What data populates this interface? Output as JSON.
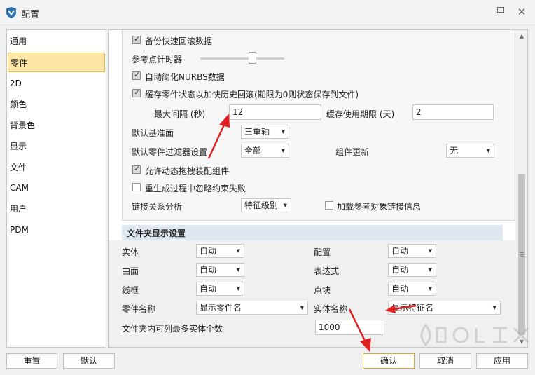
{
  "window": {
    "title": "配置"
  },
  "colors": {
    "accent": "#fde6a8",
    "accent_border": "#e9b84f",
    "annotation_arrow": "#e02020"
  },
  "sidebar": {
    "items": [
      {
        "label": "通用",
        "selected": false
      },
      {
        "label": "零件",
        "selected": true
      },
      {
        "label": "2D",
        "selected": false
      },
      {
        "label": "颜色",
        "selected": false
      },
      {
        "label": "背景色",
        "selected": false
      },
      {
        "label": "显示",
        "selected": false
      },
      {
        "label": "文件",
        "selected": false
      },
      {
        "label": "CAM",
        "selected": false
      },
      {
        "label": "用户",
        "selected": false
      },
      {
        "label": "PDM",
        "selected": false
      }
    ]
  },
  "options": {
    "backup_rollback": {
      "label": "备份快速回滚数据",
      "checked": true
    },
    "ref_timer": {
      "label": "参考点计时器"
    },
    "auto_simplify": {
      "label": "自动简化NURBS数据",
      "checked": true
    },
    "cache_state": {
      "label": "缓存零件状态以加快历史回滚(期限为0则状态保存到文件)",
      "checked": true
    },
    "max_interval": {
      "label": "最大间隔 (秒)",
      "value": "12"
    },
    "cache_limit": {
      "label": "缓存使用期限 (天)",
      "value": "2"
    },
    "default_plane": {
      "label": "默认基准面",
      "value": "三重轴"
    },
    "default_filter": {
      "label": "默认零件过滤器设置",
      "value": "全部"
    },
    "component_update": {
      "label": "组件更新",
      "value": "无"
    },
    "allow_drag": {
      "label": "允许动态拖拽装配组件",
      "checked": true
    },
    "ignore_constraint": {
      "label": "重生成过程中忽略约束失败",
      "checked": false
    },
    "link_analysis": {
      "label": "链接关系分析",
      "value": "特征级别"
    },
    "load_ref_link": {
      "label": "加载参考对象链接信息",
      "checked": false
    }
  },
  "folder_display": {
    "title": "文件夹显示设置",
    "solid": {
      "label": "实体",
      "value": "自动"
    },
    "config": {
      "label": "配置",
      "value": "自动"
    },
    "surface": {
      "label": "曲面",
      "value": "自动"
    },
    "expression": {
      "label": "表达式",
      "value": "自动"
    },
    "wireframe": {
      "label": "线框",
      "value": "自动"
    },
    "point_block": {
      "label": "点块",
      "value": "自动"
    },
    "part_name": {
      "label": "零件名称",
      "value": "显示零件名"
    },
    "entity_name": {
      "label": "实体名称",
      "value": "显示特征名"
    },
    "max_entities": {
      "label": "文件夹内可列最多实体个数",
      "value": "1000"
    }
  },
  "buttons": {
    "reset": "重置",
    "default": "默认",
    "ok": "确认",
    "cancel": "取消",
    "apply": "应用"
  }
}
